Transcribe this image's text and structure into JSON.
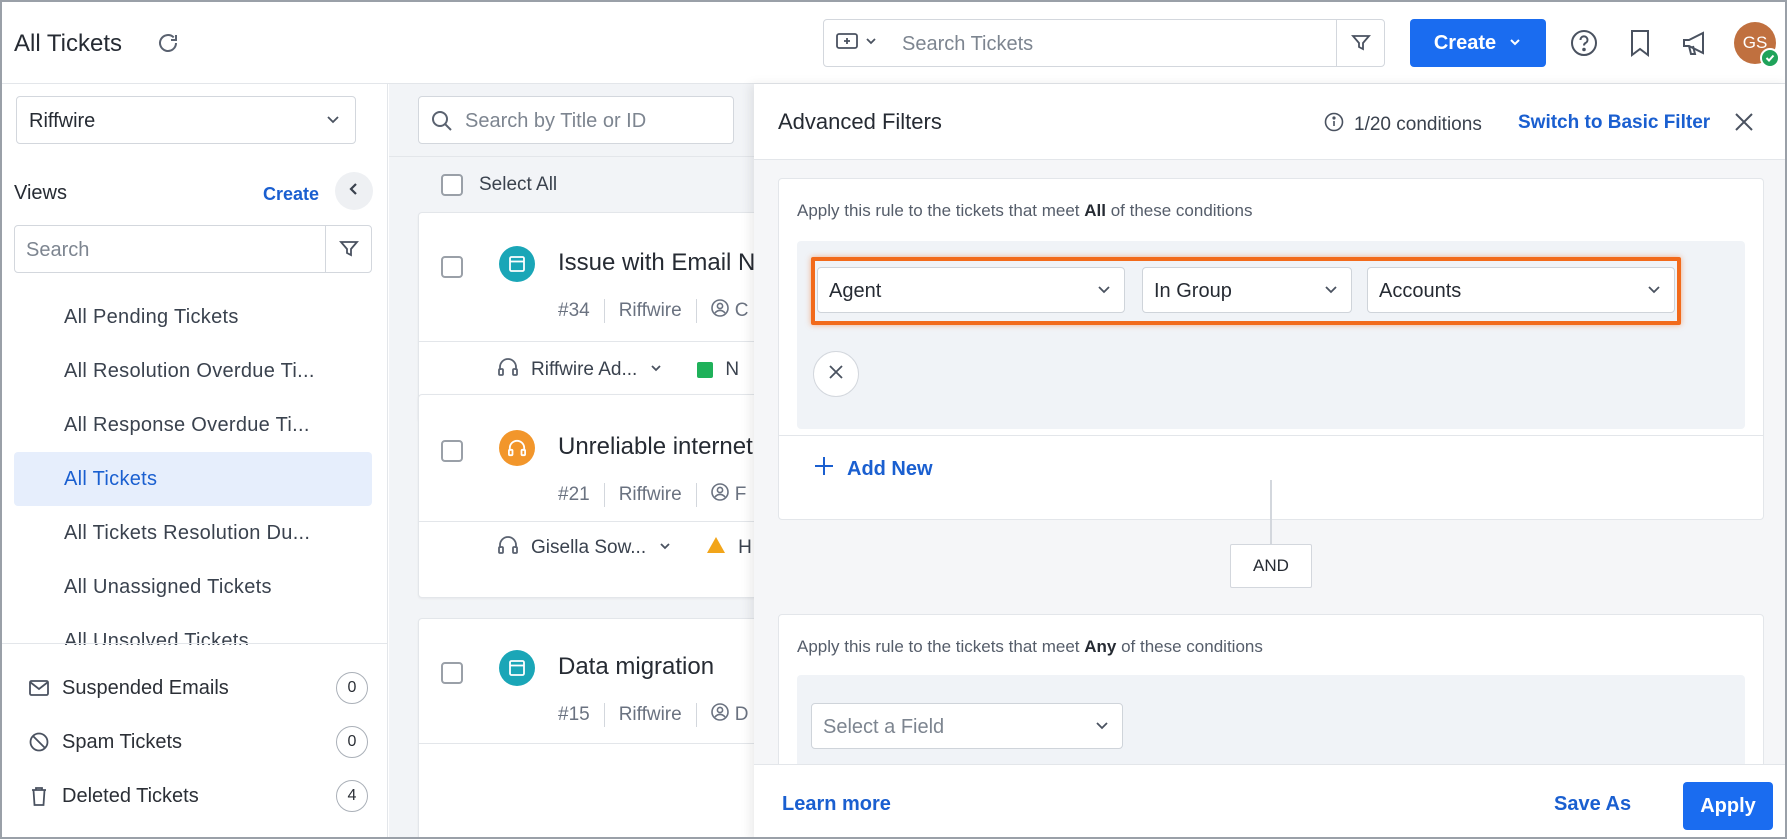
{
  "header": {
    "title": "All Tickets",
    "search_placeholder": "Search Tickets",
    "create_label": "Create",
    "avatar_initials": "GS"
  },
  "sidebar": {
    "org": "Riffwire",
    "views_title": "Views",
    "views_create": "Create",
    "search_placeholder": "Search",
    "views": [
      {
        "label": "All Pending Tickets"
      },
      {
        "label": "All Resolution Overdue Ti..."
      },
      {
        "label": "All Response Overdue Ti..."
      },
      {
        "label": "All Tickets"
      },
      {
        "label": "All Tickets Resolution Du..."
      },
      {
        "label": "All Unassigned Tickets"
      },
      {
        "label": "All Unsolved Tickets"
      }
    ],
    "footer": [
      {
        "label": "Suspended Emails",
        "count": "0"
      },
      {
        "label": "Spam Tickets",
        "count": "0"
      },
      {
        "label": "Deleted Tickets",
        "count": "4"
      }
    ]
  },
  "list": {
    "search_placeholder": "Search by Title or ID",
    "select_all": "Select All",
    "tickets": [
      {
        "title": "Issue with Email N",
        "id": "#34",
        "org": "Riffwire",
        "owner": "C",
        "agent": "Riffwire Ad...",
        "status": "N",
        "icon": "window-icon",
        "icon_color": "#1aa6b7"
      },
      {
        "title": "Unreliable internet",
        "id": "#21",
        "org": "Riffwire",
        "owner": "F",
        "agent": "Gisella Sow...",
        "status": "H",
        "icon": "headset-icon",
        "icon_color": "#f2962b"
      },
      {
        "title": "Data migration",
        "id": "#15",
        "org": "Riffwire",
        "owner": "D",
        "agent": "",
        "status": "",
        "icon": "window-icon",
        "icon_color": "#1aa6b7"
      }
    ]
  },
  "filters": {
    "title": "Advanced Filters",
    "conditions": "1/20 conditions",
    "switch_label": "Switch to Basic Filter",
    "rule1": {
      "prefix": "Apply this rule to the tickets that meet ",
      "mode": "All",
      "suffix": " of these conditions"
    },
    "condition": {
      "field": "Agent",
      "operator": "In Group",
      "value": "Accounts"
    },
    "add_new": "Add New",
    "joiner": "AND",
    "rule2": {
      "prefix": "Apply this rule to the tickets that meet ",
      "mode": "Any",
      "suffix": " of these conditions"
    },
    "field_placeholder": "Select a Field",
    "learn_more": "Learn more",
    "save_as": "Save As",
    "apply": "Apply"
  },
  "colors": {
    "accent": "#1a6cf0",
    "highlight": "#f26a1b",
    "online": "#1fa35a",
    "status_new": "#1fb15a",
    "status_high": "#f2a51a"
  }
}
